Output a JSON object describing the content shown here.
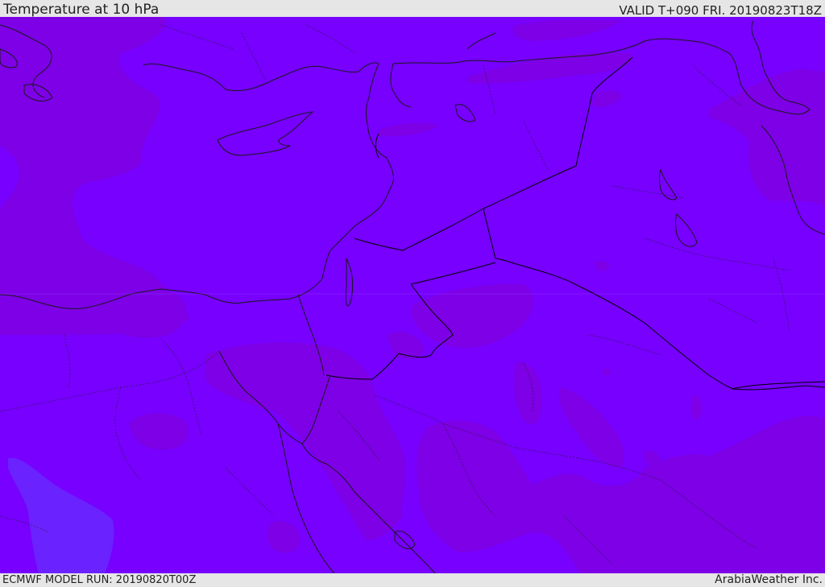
{
  "header": {
    "title": "Temperature at 10 hPa",
    "valid_time": "VALID T+090 FRI. 20190823T18Z"
  },
  "footer": {
    "model_run": "ECMWF MODEL RUN: 20190820T00Z",
    "credit": "ArabiaWeather Inc."
  },
  "map": {
    "colors": {
      "base": "#7700ff",
      "warm_patch": "#7d00e6",
      "cool_patch": "#6a22ff",
      "coast": "#1a1a1a",
      "border": "#000000"
    }
  }
}
